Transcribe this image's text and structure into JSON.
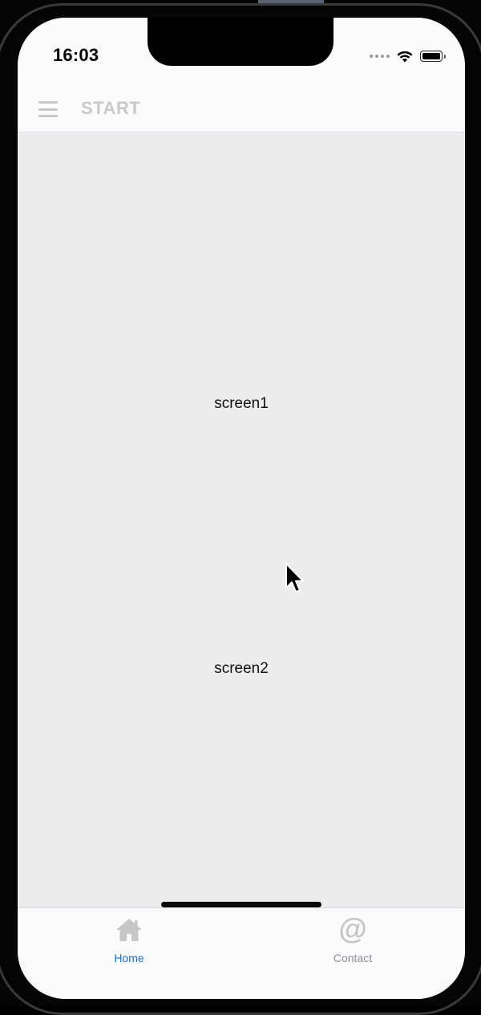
{
  "status_bar": {
    "time": "16:03"
  },
  "header": {
    "title": "START",
    "menu_icon": "hamburger-menu-icon"
  },
  "content": {
    "screen1_label": "screen1",
    "screen2_label": "screen2",
    "background_color": "#edecef"
  },
  "tabbar": {
    "tabs": [
      {
        "label": "Home",
        "icon": "home-icon",
        "active": true,
        "color": "#1a73c2"
      },
      {
        "label": "Contact",
        "icon": "at-sign-icon",
        "active": false,
        "color": "#8e8e93"
      }
    ]
  },
  "colors": {
    "active_tab": "#1a73c2",
    "inactive_icon": "#c6c6c8",
    "header_bg": "#fbfafd"
  }
}
